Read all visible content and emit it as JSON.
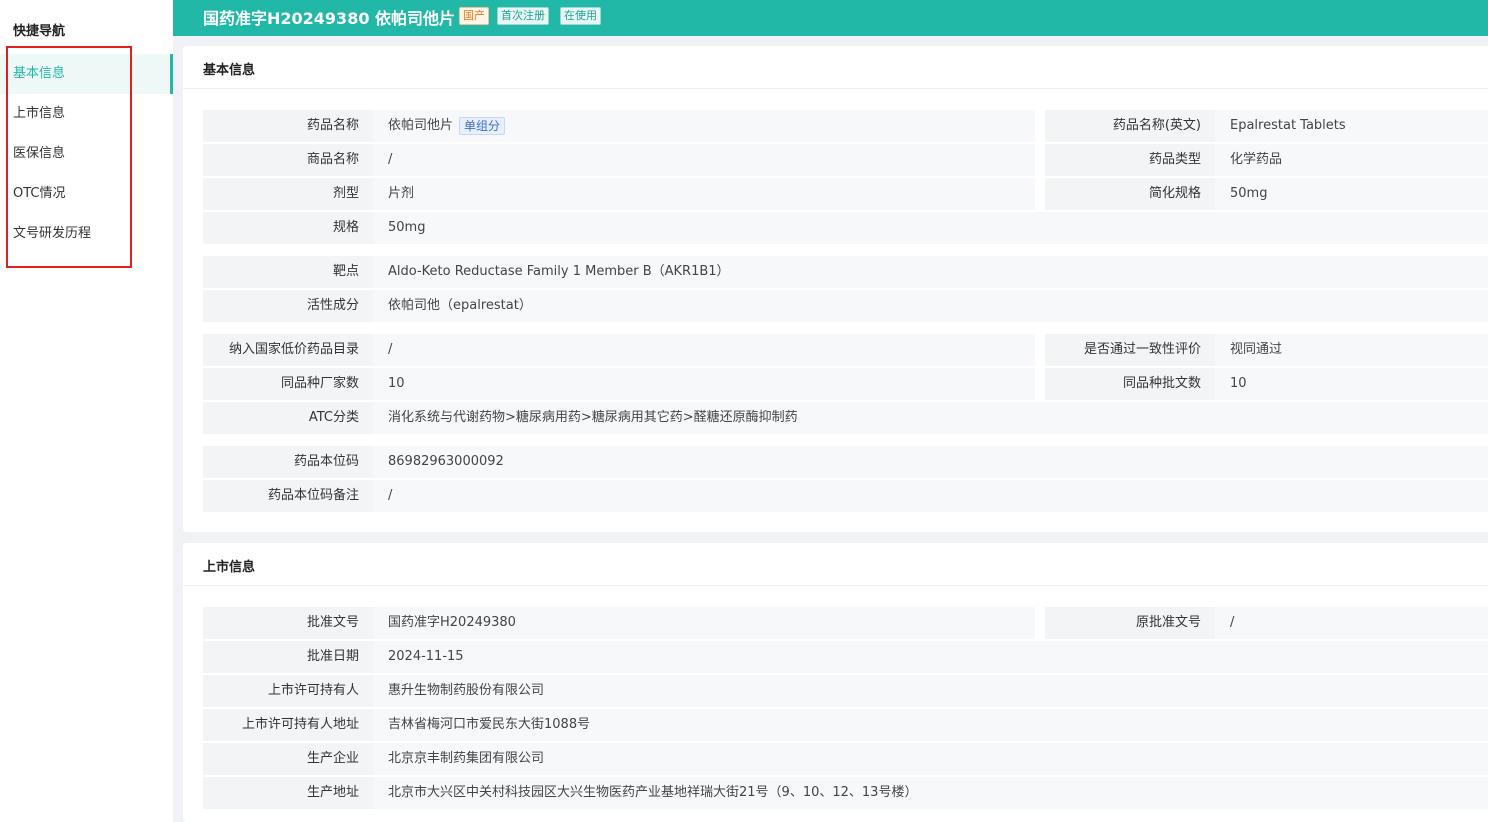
{
  "sidebar": {
    "title": "快捷导航",
    "items": [
      {
        "label": "基本信息",
        "active": true
      },
      {
        "label": "上市信息",
        "active": false
      },
      {
        "label": "医保信息",
        "active": false
      },
      {
        "label": "OTC情况",
        "active": false
      },
      {
        "label": "文号研发历程",
        "active": false
      }
    ]
  },
  "header": {
    "title": "国药准字H20249380  依帕司他片",
    "tags": [
      "国产",
      "首次注册",
      "在使用"
    ]
  },
  "basic_info": {
    "title": "基本信息",
    "drug_name_label": "药品名称",
    "drug_name_value": "依帕司他片",
    "drug_name_badge": "单组分",
    "drug_name_en_label": "药品名称(英文)",
    "drug_name_en_value": "Epalrestat Tablets",
    "trade_name_label": "商品名称",
    "trade_name_value": "/",
    "drug_type_label": "药品类型",
    "drug_type_value": "化学药品",
    "dosage_form_label": "剂型",
    "dosage_form_value": "片剂",
    "simple_spec_label": "简化规格",
    "simple_spec_value": "50mg",
    "spec_label": "规格",
    "spec_value": "50mg",
    "target_label": "靶点",
    "target_value": "Aldo-Keto Reductase Family 1 Member B（AKR1B1）",
    "active_ingredient_label": "活性成分",
    "active_ingredient_value": "依帕司他（epalrestat）",
    "low_price_label": "纳入国家低价药品目录",
    "low_price_value": "/",
    "consistency_label": "是否通过一致性评价",
    "consistency_value": "视同通过",
    "mfr_count_label": "同品种厂家数",
    "mfr_count_value": "10",
    "approval_count_label": "同品种批文数",
    "approval_count_value": "10",
    "atc_label": "ATC分类",
    "atc_value": "消化系统与代谢药物>糖尿病用药>糖尿病用其它药>醛糖还原酶抑制药",
    "code_label": "药品本位码",
    "code_value": "86982963000092",
    "code_note_label": "药品本位码备注",
    "code_note_value": "/"
  },
  "market_info": {
    "title": "上市信息",
    "approval_no_label": "批准文号",
    "approval_no_value": "国药准字H20249380",
    "orig_approval_label": "原批准文号",
    "orig_approval_value": "/",
    "approval_date_label": "批准日期",
    "approval_date_value": "2024-11-15",
    "holder_label": "上市许可持有人",
    "holder_value": "惠升生物制药股份有限公司",
    "holder_addr_label": "上市许可持有人地址",
    "holder_addr_value": "吉林省梅河口市爱民东大街1088号",
    "manufacturer_label": "生产企业",
    "manufacturer_value": "北京京丰制药集团有限公司",
    "mfr_addr_label": "生产地址",
    "mfr_addr_value": "北京市大兴区中关村科技园区大兴生物医药产业基地祥瑞大街21号（9、10、12、13号楼）"
  },
  "colors": {
    "accent": "#21b8a8",
    "highlight_border": "#e0201d",
    "tag_orange": "#f07a1e"
  }
}
